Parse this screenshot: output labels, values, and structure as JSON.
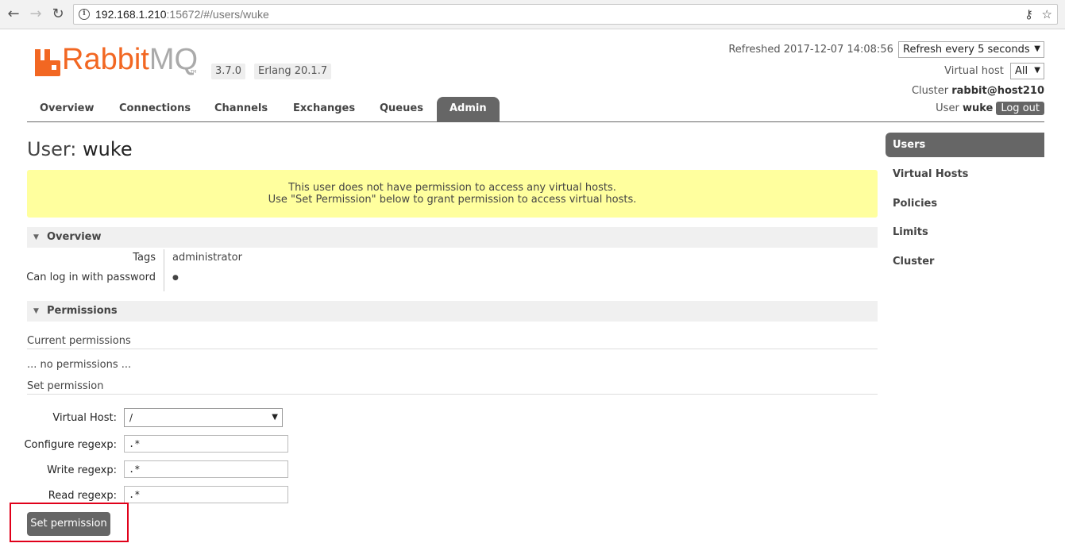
{
  "browser": {
    "url_host": "192.168.1.210",
    "url_rest": ":15672/#/users/wuke"
  },
  "header": {
    "logo_rabbit": "Rabbit",
    "logo_mq": "MQ",
    "logo_tm": "TM",
    "version": "3.7.0",
    "erlang": "Erlang 20.1.7",
    "refreshed": "Refreshed 2017-12-07 14:08:56",
    "refresh_select": "Refresh every 5 seconds",
    "vhost_label": "Virtual host",
    "vhost_select": "All",
    "cluster_label": "Cluster",
    "cluster_value": "rabbit@host210",
    "user_label": "User",
    "user_value": "wuke",
    "logout": "Log out"
  },
  "tabs": [
    {
      "label": "Overview"
    },
    {
      "label": "Connections"
    },
    {
      "label": "Channels"
    },
    {
      "label": "Exchanges"
    },
    {
      "label": "Queues"
    },
    {
      "label": "Admin",
      "active": true
    }
  ],
  "page": {
    "title_prefix": "User:",
    "title_name": "wuke",
    "warning_line1": "This user does not have permission to access any virtual hosts.",
    "warning_line2": "Use \"Set Permission\" below to grant permission to access virtual hosts."
  },
  "overview": {
    "heading": "Overview",
    "tags_label": "Tags",
    "tags_value": "administrator",
    "login_label": "Can log in with password",
    "login_value": "●"
  },
  "permissions": {
    "heading": "Permissions",
    "current_heading": "Current permissions",
    "none_text": "... no permissions ...",
    "set_heading": "Set permission",
    "vhost_label": "Virtual Host:",
    "vhost_value": "/",
    "configure_label": "Configure regexp:",
    "configure_value": ".*",
    "write_label": "Write regexp:",
    "write_value": ".*",
    "read_label": "Read regexp:",
    "read_value": ".*",
    "submit": "Set permission"
  },
  "sidebar": {
    "items": [
      {
        "label": "Users",
        "active": true
      },
      {
        "label": "Virtual Hosts"
      },
      {
        "label": "Policies"
      },
      {
        "label": "Limits"
      },
      {
        "label": "Cluster"
      }
    ]
  },
  "colors": {
    "brand_orange": "#f26722",
    "nav_active": "#666666",
    "warning_bg": "#ffff9e",
    "highlight_red": "#e0001a"
  }
}
